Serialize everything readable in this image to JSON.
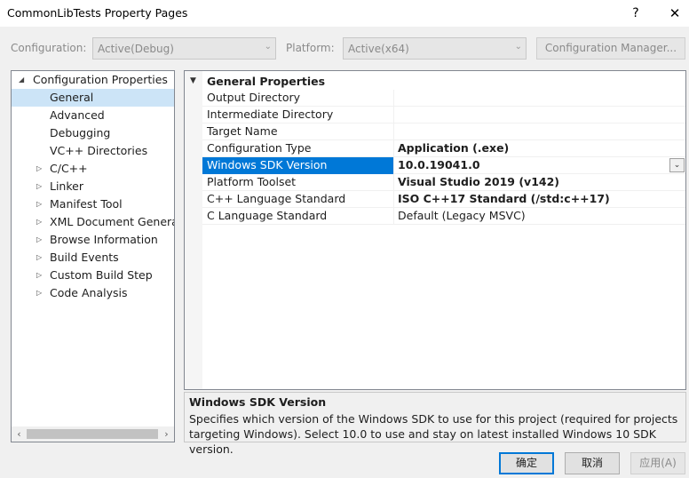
{
  "window": {
    "title": "CommonLibTests Property Pages",
    "help_glyph": "?",
    "close_glyph": "✕"
  },
  "config_bar": {
    "configuration_label": "Configuration:",
    "configuration_value": "Active(Debug)",
    "platform_label": "Platform:",
    "platform_value": "Active(x64)",
    "manager_button": "Configuration Manager..."
  },
  "tree": {
    "items": [
      {
        "label": "Configuration Properties",
        "expanded": true
      },
      {
        "label": "General",
        "selected": true
      },
      {
        "label": "Advanced"
      },
      {
        "label": "Debugging"
      },
      {
        "label": "VC++ Directories"
      },
      {
        "label": "C/C++"
      },
      {
        "label": "Linker"
      },
      {
        "label": "Manifest Tool"
      },
      {
        "label": "XML Document Generat"
      },
      {
        "label": "Browse Information"
      },
      {
        "label": "Build Events"
      },
      {
        "label": "Custom Build Step"
      },
      {
        "label": "Code Analysis"
      }
    ]
  },
  "grid": {
    "section_title": "General Properties",
    "rows": [
      {
        "name": "Output Directory",
        "value": ""
      },
      {
        "name": "Intermediate Directory",
        "value": ""
      },
      {
        "name": "Target Name",
        "value": ""
      },
      {
        "name": "Configuration Type",
        "value": "Application (.exe)"
      },
      {
        "name": "Windows SDK Version",
        "value": "10.0.19041.0"
      },
      {
        "name": "Platform Toolset",
        "value": "Visual Studio 2019 (v142)"
      },
      {
        "name": "C++ Language Standard",
        "value": "ISO C++17 Standard (/std:c++17)"
      },
      {
        "name": "C Language Standard",
        "value": "Default (Legacy MSVC)"
      }
    ]
  },
  "description": {
    "title": "Windows SDK Version",
    "text": "Specifies which version of the Windows SDK to use for this project (required for projects targeting Windows). Select 10.0 to use and stay on latest installed Windows 10 SDK version."
  },
  "buttons": {
    "ok": "确定",
    "cancel": "取消",
    "apply": "应用(A)"
  },
  "colors": {
    "selection_blue": "#0078d7",
    "tree_selection": "#cce4f7"
  }
}
